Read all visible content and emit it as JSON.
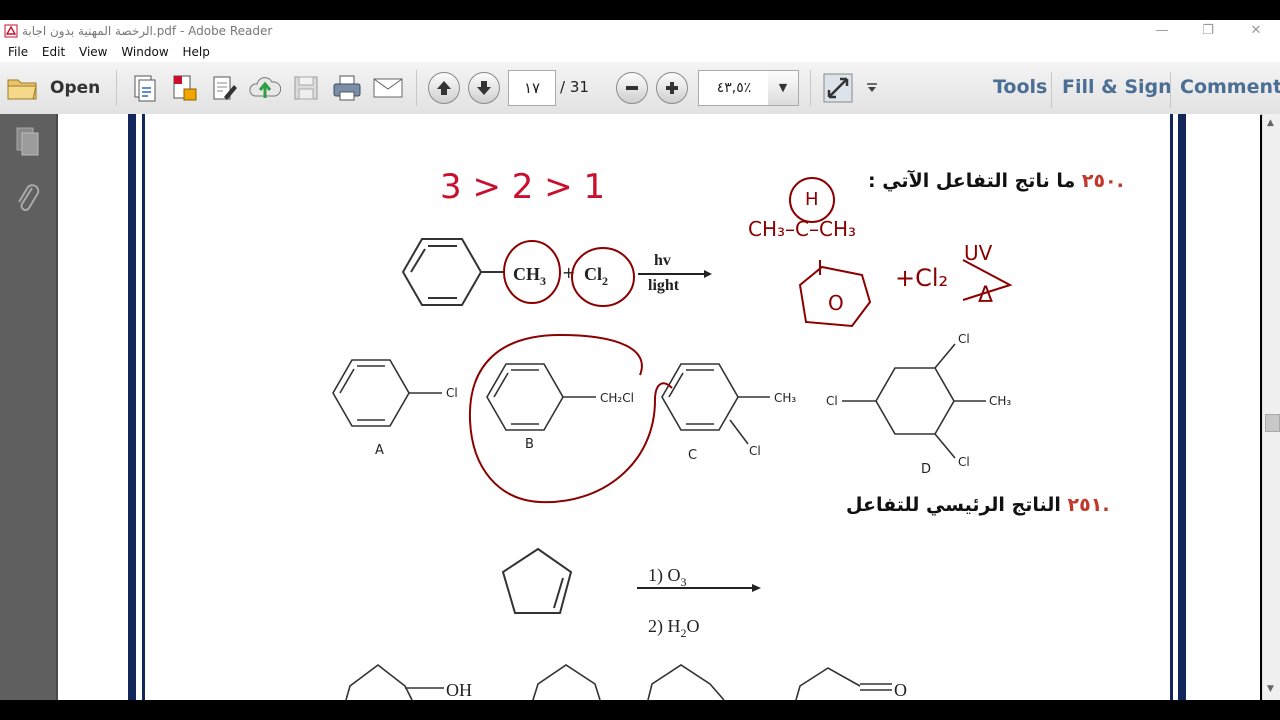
{
  "window": {
    "title": "الرخصة المهنية بدون اجابة.pdf - Adobe Reader",
    "minimize": "—",
    "restore": "❐",
    "close": "✕"
  },
  "menu": [
    "File",
    "Edit",
    "View",
    "Window",
    "Help"
  ],
  "toolbar": {
    "open_label": "Open",
    "page_current": "١٧",
    "page_total": "/ 31",
    "zoom": "٤٣,٥٪",
    "tools": "Tools",
    "fill_sign": "Fill & Sign",
    "comment": "Comment"
  },
  "icons": [
    "open-folder-icon",
    "create-pdf-icon",
    "export-pdf-icon",
    "edit-icon",
    "upload-icon",
    "save-icon",
    "print-icon",
    "email-icon",
    "prev-page-icon",
    "next-page-icon",
    "zoom-out-icon",
    "zoom-in-icon",
    "read-mode-icon",
    "more-tools-icon",
    "pages-panel-icon",
    "attachments-panel-icon"
  ],
  "document": {
    "q250_number": ".٢٥٠",
    "q250_text": "ما ناتج التفاعل الآتي :",
    "q251_number": ".٢٥١",
    "q251_text": "الناتج الرئيسي للتفاعل",
    "reaction1": {
      "ch3": "CH",
      "ch3_sub": "3",
      "cl2": "Cl",
      "cl2_sub": "2",
      "hv": "hv",
      "light": "light"
    },
    "options1": {
      "A": {
        "letter": "A",
        "sub": "Cl"
      },
      "B": {
        "letter": "B",
        "sub": "CH₂Cl"
      },
      "C": {
        "letter": "C",
        "sub1": "CH₃",
        "sub2": "Cl"
      },
      "D": {
        "letter": "D",
        "sub1": "Cl",
        "sub2": "Cl",
        "sub3": "CH₃",
        "sub4": "Cl"
      }
    },
    "reaction2": {
      "step1": "1)  O",
      "step1_sub": "3",
      "step2": "2) H",
      "step2_sub": "2",
      "step2_end": "O"
    },
    "options2": {
      "oh": "OH",
      "o": "O"
    },
    "handwriting": {
      "order": "3 > 2 > 1",
      "h": "H",
      "formula_left": "CH₃–C–CH₃",
      "ring": "O",
      "cl2": "+Cl₂",
      "uv": "UV",
      "delta": "Δ"
    }
  },
  "colors": {
    "accent": "#4a6e94",
    "navy": "#12265c",
    "ink": "#8b0000",
    "red_ink": "#c8102e"
  }
}
